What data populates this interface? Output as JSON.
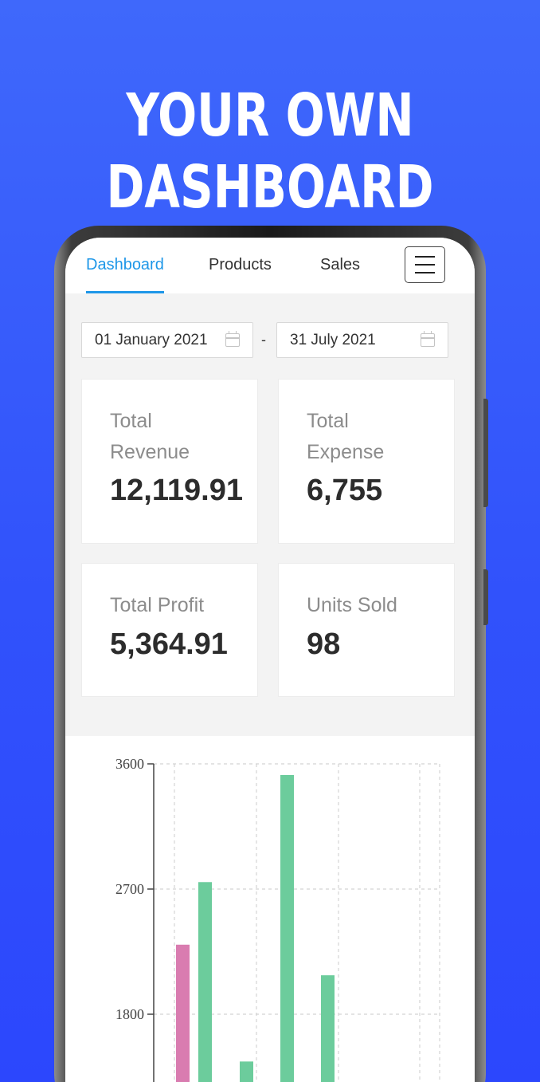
{
  "headline": "YOUR OWN DASHBOARD",
  "nav": {
    "tabs": [
      {
        "label": "Dashboard",
        "active": true
      },
      {
        "label": "Products",
        "active": false
      },
      {
        "label": "Sales",
        "active": false
      }
    ]
  },
  "date_range": {
    "start": "01 January 2021",
    "end": "31 July 2021",
    "separator": "-"
  },
  "stats": [
    {
      "label": "Total Revenue",
      "value": "12,119.91"
    },
    {
      "label": "Total Expense",
      "value": "6,755"
    },
    {
      "label": "Total Profit",
      "value": "5,364.91"
    },
    {
      "label": "Units Sold",
      "value": "98"
    }
  ],
  "colors": {
    "accent": "#1e97e8",
    "background": "#3f68fb",
    "bar_green": "#6ccc9c",
    "bar_pink": "#d97cb0"
  },
  "chart_data": {
    "type": "bar",
    "ylim": [
      0,
      3600
    ],
    "yticks": [
      "3600",
      "2700",
      "1800"
    ],
    "grid": true,
    "series": [
      {
        "color": "#d97cb0",
        "values": [
          2300
        ]
      },
      {
        "color": "#6ccc9c",
        "values": [
          2750,
          1460,
          3520,
          2080
        ]
      }
    ]
  }
}
